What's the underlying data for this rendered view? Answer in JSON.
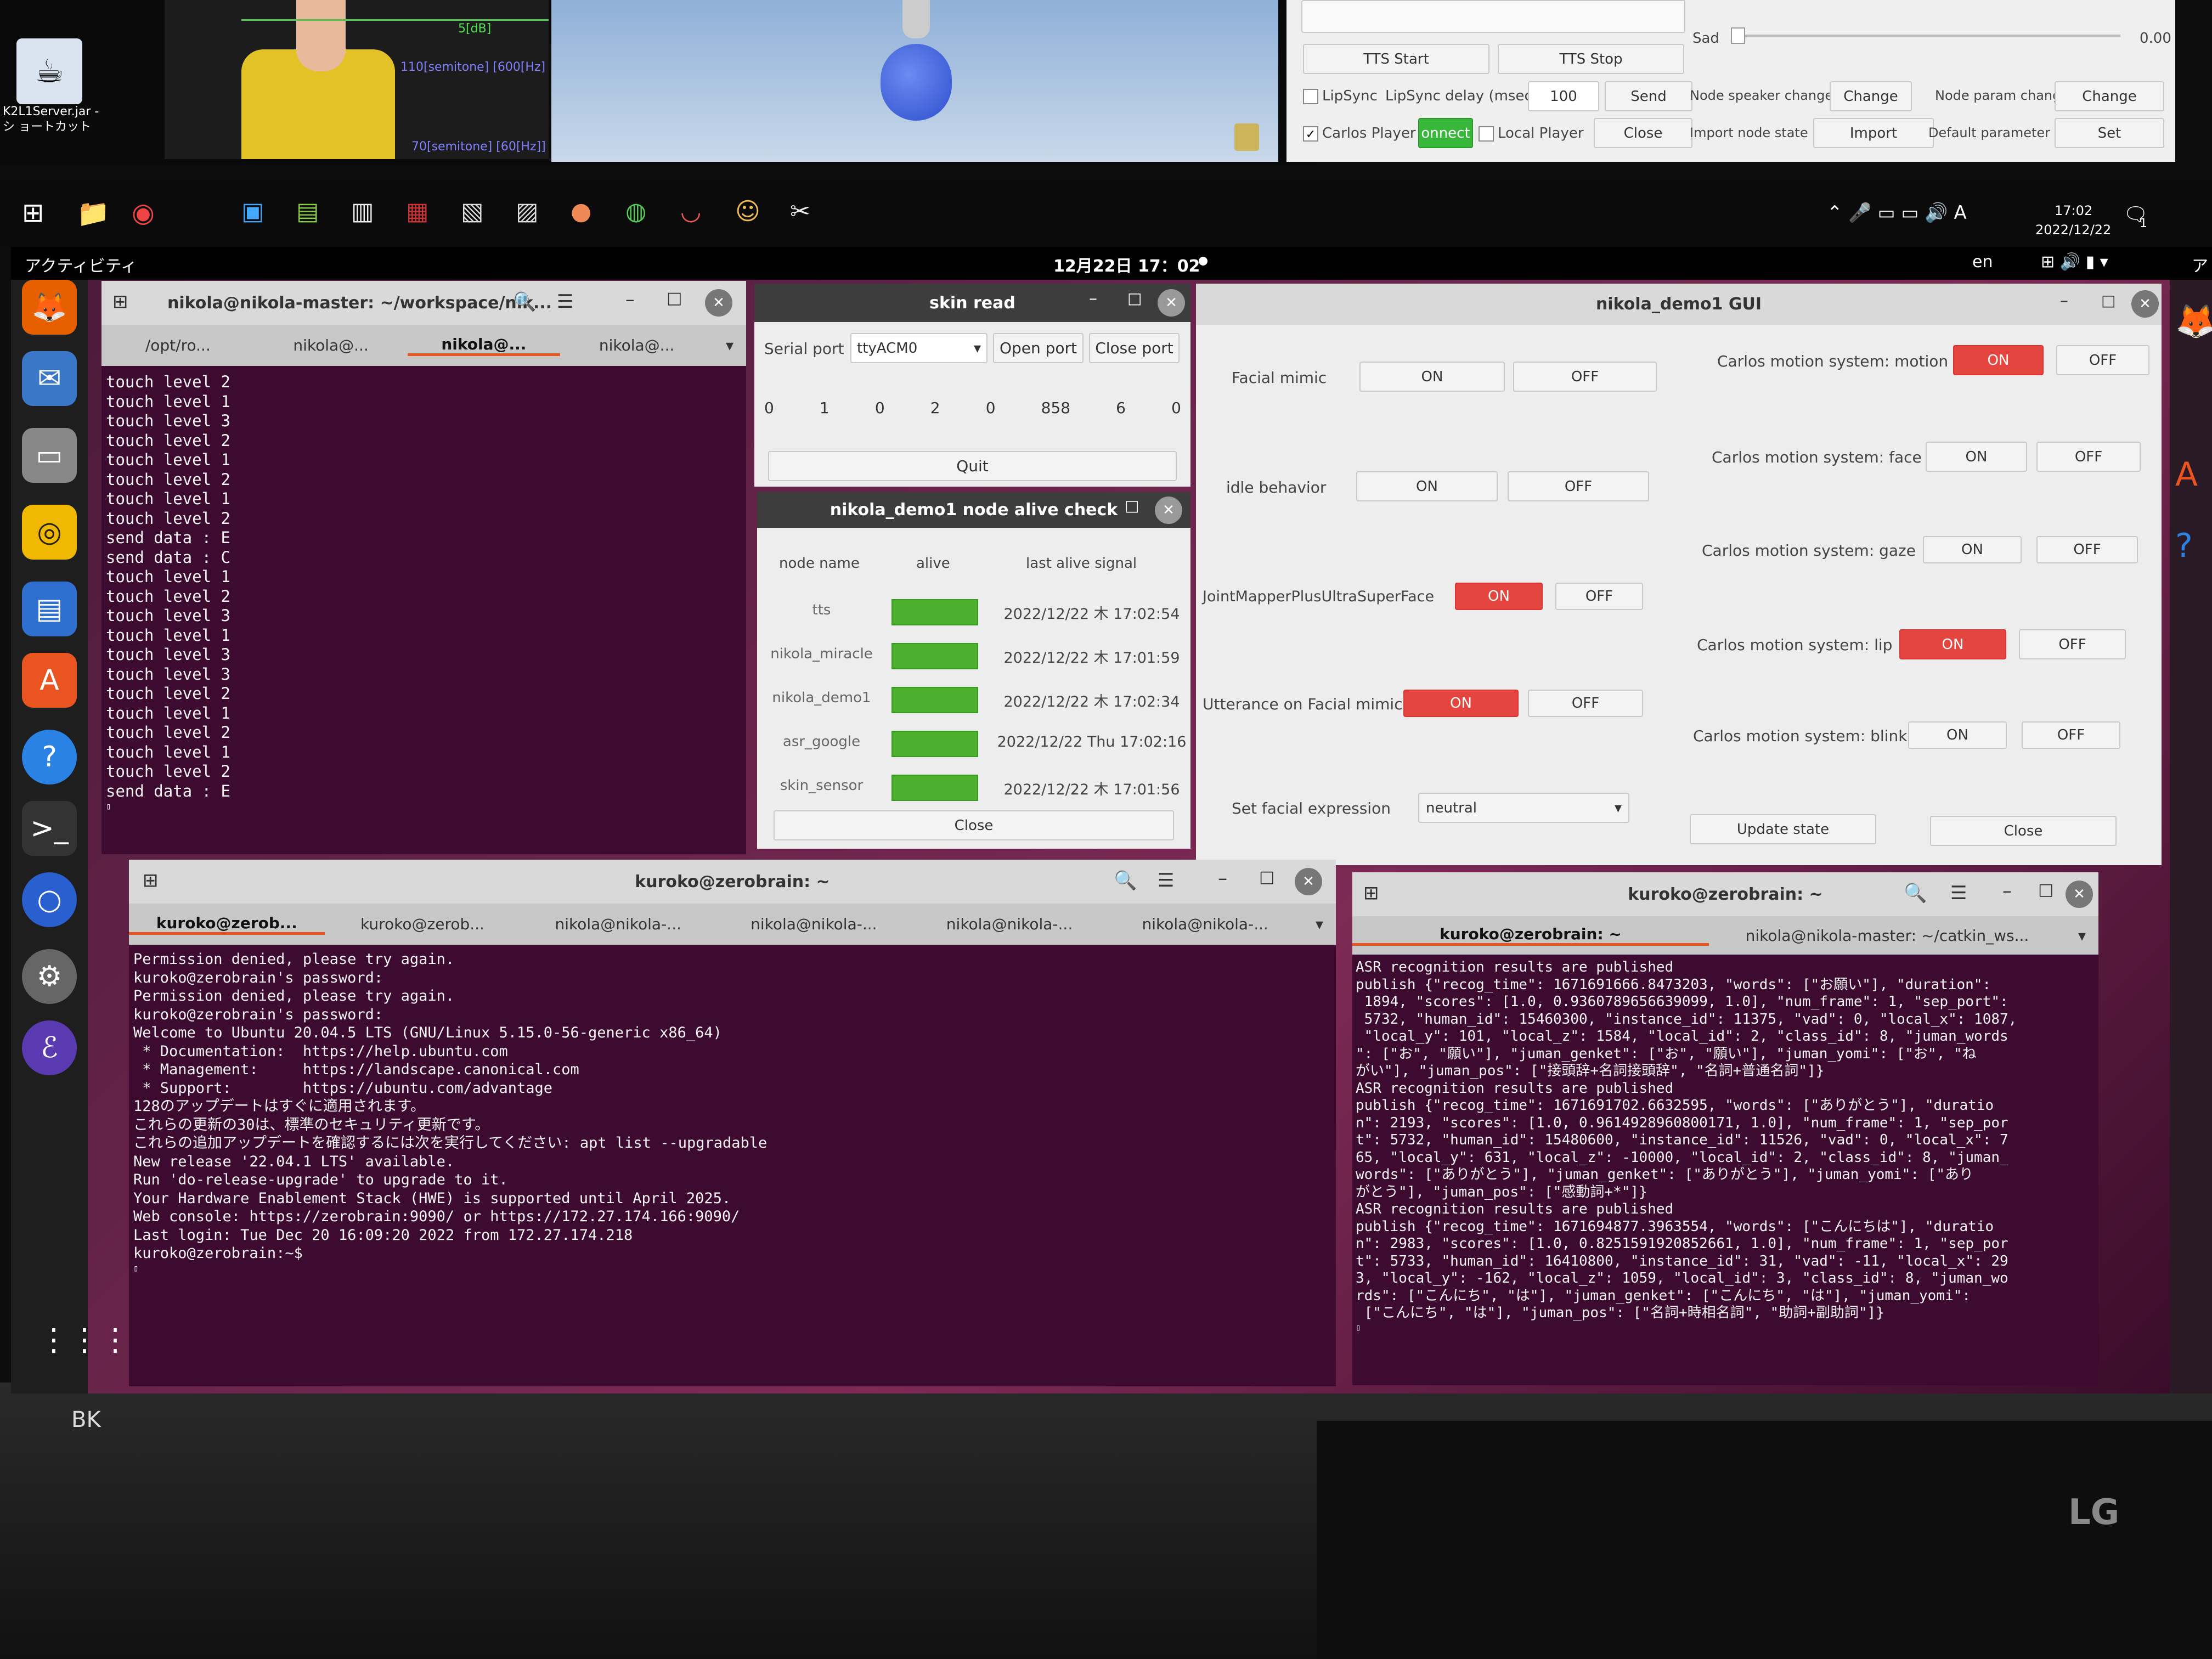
{
  "topbar_left": {
    "shortcut_label": "K2L1Server.jar - シ ョートカット"
  },
  "video_overlay": {
    "db_label": "5[dB]",
    "semitone1": "110[semitone] [600[Hz]",
    "semitone2": "70[semitone] [60[Hz]]"
  },
  "tts_panel": {
    "sad_label": "Sad",
    "sad_value": "0.00",
    "tts_start": "TTS Start",
    "tts_stop": "TTS Stop",
    "lipsync": "LipSync",
    "lipsync_delay": "LipSync delay (msec)",
    "delay_value": "100",
    "send": "Send",
    "node_speaker_change": "Node speaker change",
    "change1": "Change",
    "node_param_change": "Node param change",
    "change2": "Change",
    "carlos_player": "Carlos Player",
    "connect": "onnect",
    "local_player": "Local Player",
    "close": "Close",
    "import_node_state": "Import node state",
    "import": "Import",
    "default_parameter": "Default parameter",
    "set": "Set"
  },
  "taskbar": {
    "date_small": "2022/12/22",
    "time_small": "17:02",
    "notif": "1"
  },
  "gnome_top": {
    "activities": "アクティビティ",
    "clock": "12月22日 17：02",
    "lang": "en",
    "right_cut": "アク"
  },
  "term1": {
    "title": "nikola@nikola-master: ~/workspace/nik...",
    "tabs": [
      "/opt/ro...",
      "nikola@...",
      "nikola@...",
      "nikola@..."
    ],
    "lines": [
      "touch level 2",
      "touch level 1",
      "touch level 3",
      "touch level 2",
      "touch level 1",
      "touch level 2",
      "touch level 1",
      "touch level 2",
      "send data : E",
      "send data : C",
      "touch level 1",
      "touch level 2",
      "touch level 3",
      "touch level 1",
      "touch level 3",
      "touch level 3",
      "touch level 2",
      "touch level 1",
      "touch level 2",
      "touch level 1",
      "touch level 2",
      "send data : E"
    ]
  },
  "skin_read": {
    "title": "skin read",
    "serial_port": "Serial port",
    "port_value": "ttyACM0",
    "open_port": "Open port",
    "close_port": "Close port",
    "values": [
      "0",
      "1",
      "0",
      "2",
      "0",
      "858",
      "6",
      "0"
    ],
    "quit": "Quit"
  },
  "alive_check": {
    "title": "nikola_demo1 node alive check",
    "headers": [
      "node name",
      "alive",
      "last alive signal"
    ],
    "rows": [
      {
        "name": "tts",
        "signal": "2022/12/22 木 17:02:54"
      },
      {
        "name": "nikola_miracle",
        "signal": "2022/12/22 木 17:01:59"
      },
      {
        "name": "nikola_demo1",
        "signal": "2022/12/22 木 17:02:34"
      },
      {
        "name": "asr_google",
        "signal": "2022/12/22 Thu 17:02:16"
      },
      {
        "name": "skin_sensor",
        "signal": "2022/12/22 木 17:01:56"
      }
    ],
    "close": "Close"
  },
  "demo_gui": {
    "title": "nikola_demo1 GUI",
    "facial_mimic": "Facial mimic",
    "idle_behavior": "idle behavior",
    "joint_mapper": "JointMapperPlusUltraSuperFace",
    "utterance": "Utterance on Facial mimic",
    "set_facial": "Set facial expression",
    "expression": "neutral",
    "on": "ON",
    "off": "OFF",
    "carlos_motion": "Carlos motion system: motion",
    "carlos_face": "Carlos motion system: face",
    "carlos_gaze": "Carlos motion system: gaze",
    "carlos_lip": "Carlos motion system: lip",
    "carlos_blink": "Carlos motion system: blink",
    "update_state": "Update state",
    "close": "Close"
  },
  "term2": {
    "title": "kuroko@zerobrain: ~",
    "tabs": [
      "kuroko@zerob...",
      "kuroko@zerob...",
      "nikola@nikola-...",
      "nikola@nikola-...",
      "nikola@nikola-...",
      "nikola@nikola-..."
    ],
    "lines": [
      "Permission denied, please try again.",
      "kuroko@zerobrain's password:",
      "Permission denied, please try again.",
      "kuroko@zerobrain's password:",
      "Welcome to Ubuntu 20.04.5 LTS (GNU/Linux 5.15.0-56-generic x86_64)",
      "",
      " * Documentation:  https://help.ubuntu.com",
      " * Management:     https://landscape.canonical.com",
      " * Support:        https://ubuntu.com/advantage",
      "",
      "128のアップデートはすぐに適用されます。",
      "これらの更新の30は、標準のセキュリティ更新です。",
      "これらの追加アップデートを確認するには次を実行してください: apt list --upgradable",
      "",
      "New release '22.04.1 LTS' available.",
      "Run 'do-release-upgrade' to upgrade to it.",
      "",
      "Your Hardware Enablement Stack (HWE) is supported until April 2025.",
      "Web console: https://zerobrain:9090/ or https://172.27.174.166:9090/",
      "",
      "Last login: Tue Dec 20 16:09:20 2022 from 172.27.174.218",
      "kuroko@zerobrain:~$ "
    ]
  },
  "term3": {
    "title": "kuroko@zerobrain: ~",
    "tabs": [
      "kuroko@zerobrain: ~",
      "nikola@nikola-master: ~/catkin_ws..."
    ],
    "lines": [
      "ASR recognition results are published",
      "publish {\"recog_time\": 1671691666.8473203, \"words\": [\"お願い\"], \"duration\":",
      " 1894, \"scores\": [1.0, 0.9360789656639099, 1.0], \"num_frame\": 1, \"sep_port\":",
      " 5732, \"human_id\": 15460300, \"instance_id\": 11375, \"vad\": 0, \"local_x\": 1087,",
      " \"local_y\": 101, \"local_z\": 1584, \"local_id\": 2, \"class_id\": 8, \"juman_words",
      "\": [\"お\", \"願い\"], \"juman_genket\": [\"お\", \"願い\"], \"juman_yomi\": [\"お\", \"ね",
      "がい\"], \"juman_pos\": [\"接頭辞+名詞接頭辞\", \"名詞+普通名詞\"]}",
      "ASR recognition results are published",
      "publish {\"recog_time\": 1671691702.6632595, \"words\": [\"ありがとう\"], \"duratio",
      "n\": 2193, \"scores\": [1.0, 0.9614928960800171, 1.0], \"num_frame\": 1, \"sep_por",
      "t\": 5732, \"human_id\": 15480600, \"instance_id\": 11526, \"vad\": 0, \"local_x\": 7",
      "65, \"local_y\": 631, \"local_z\": -10000, \"local_id\": 2, \"class_id\": 8, \"juman_",
      "words\": [\"ありがとう\"], \"juman_genket\": [\"ありがとう\"], \"juman_yomi\": [\"あり",
      "がとう\"], \"juman_pos\": [\"感動詞+*\"]}",
      "ASR recognition results are published",
      "publish {\"recog_time\": 1671694877.3963554, \"words\": [\"こんにちは\"], \"duratio",
      "n\": 2983, \"scores\": [1.0, 0.8251591920852661, 1.0], \"num_frame\": 1, \"sep_por",
      "t\": 5733, \"human_id\": 16410800, \"instance_id\": 31, \"vad\": -11, \"local_x\": 29",
      "3, \"local_y\": -162, \"local_z\": 1059, \"local_id\": 3, \"class_id\": 8, \"juman_wo",
      "rds\": [\"こんにち\", \"は\"], \"juman_genket\": [\"こんにち\", \"は\"], \"juman_yomi\":",
      " [\"こんにち\", \"は\"], \"juman_pos\": [\"名詞+時相名詞\", \"助詞+副助詞\"]}"
    ]
  },
  "monitor": {
    "brand": "LG",
    "corner_label": "BK"
  }
}
